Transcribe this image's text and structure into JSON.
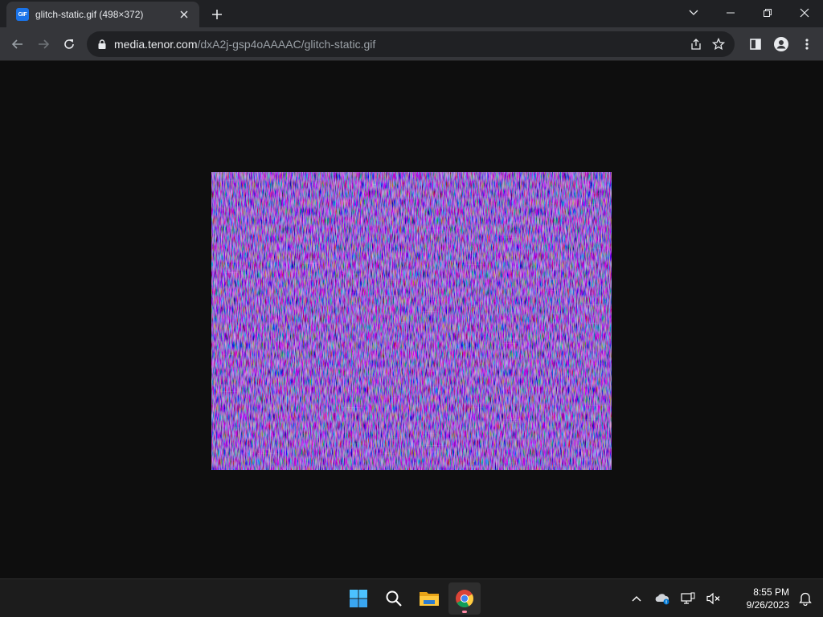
{
  "tab": {
    "title": "glitch-static.gif (498×372)",
    "favicon_text": "GIF",
    "favicon_color": "#1a73e8"
  },
  "toolbar": {
    "url_host": "media.tenor.com",
    "url_path": "/dxA2j-gsp4oAAAAC/glitch-static.gif"
  },
  "icons": {
    "tab_close": "close-icon",
    "new_tab": "plus-icon",
    "back": "arrow-left-icon",
    "forward": "arrow-right-icon",
    "reload": "reload-icon",
    "lock": "lock-icon",
    "share": "share-icon",
    "bookmark": "star-icon",
    "side_panel": "side-panel-icon",
    "profile": "profile-icon",
    "menu": "kebab-menu-icon"
  },
  "content": {
    "background": "#0e0e0e",
    "image_alt": "glitch-static.gif"
  },
  "taskbar": {
    "apps": [
      "windows-start-icon",
      "search-icon",
      "file-explorer-icon",
      "chrome-icon"
    ],
    "active_app": "chrome",
    "tray": [
      "chevron-up-icon",
      "onedrive-icon",
      "network-icon",
      "speaker-muted-icon"
    ],
    "time": "8:55 PM",
    "date": "9/26/2023"
  },
  "colors": {
    "tabstrip": "#202124",
    "toolbar": "#35363a",
    "omnibox": "#202124",
    "taskbar": "#1c1c1c",
    "accent_active": "#ff8aa6"
  }
}
